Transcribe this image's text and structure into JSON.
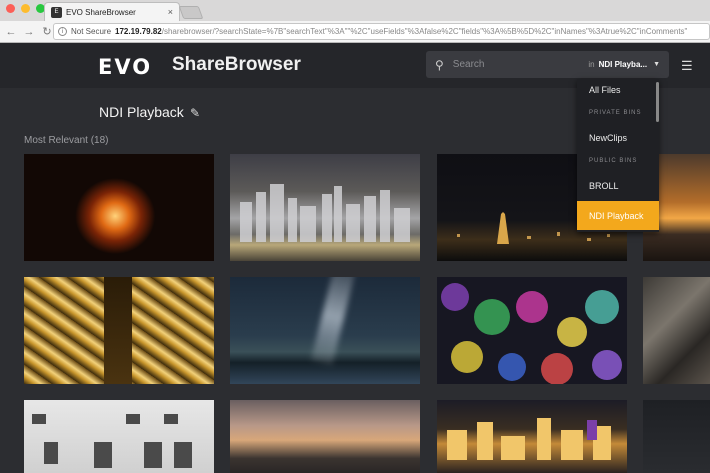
{
  "browser": {
    "tab_title": "EVO ShareBrowser",
    "tab_close": "×",
    "security_label": "Not Secure",
    "url_host": "172.19.79.82",
    "url_path": "/sharebrowser/?searchState=%7B\"searchText\"%3A\"\"%2C\"useFields\"%3Afalse%2C\"fields\"%3A%5B%5D%2C\"inNames\"%3Atrue%2C\"inComments\"",
    "colors": {
      "close": "#fc5f57",
      "minimize": "#fdbc2e",
      "maximize": "#28c840"
    }
  },
  "app": {
    "logo_text": "EVO",
    "brand_text": "ShareBrowser",
    "search": {
      "placeholder": "Search",
      "in_label": "in",
      "scope_value": "NDI Playba...",
      "icon": "search-icon"
    },
    "filter_icon": "sliders-icon"
  },
  "page": {
    "title": "NDI Playback",
    "edit_icon": "pencil-icon",
    "section_label": "Most Relevant (18)"
  },
  "dropdown": {
    "items": [
      {
        "label": "All Files",
        "type": "item"
      },
      {
        "label": "PRIVATE BINS",
        "type": "header"
      },
      {
        "label": "NewClips",
        "type": "item"
      },
      {
        "label": "PUBLIC BINS",
        "type": "header"
      },
      {
        "label": "BROLL",
        "type": "item"
      },
      {
        "label": "NDI Playback",
        "type": "item",
        "selected": true
      }
    ],
    "accent": "#f3a81c"
  },
  "thumbnails": [
    {
      "subject": "campfire at night"
    },
    {
      "subject": "city skyline with lights"
    },
    {
      "subject": "night city skyline"
    },
    {
      "subject": "sunset over mountains"
    },
    {
      "subject": "golden atrium interior"
    },
    {
      "subject": "milky way over lake"
    },
    {
      "subject": "colorful bokeh lights"
    },
    {
      "subject": "rocky cliff"
    },
    {
      "subject": "white building facade"
    },
    {
      "subject": "dusk sky over horizon"
    },
    {
      "subject": "night city lights"
    },
    {
      "subject": "dark landscape"
    }
  ]
}
